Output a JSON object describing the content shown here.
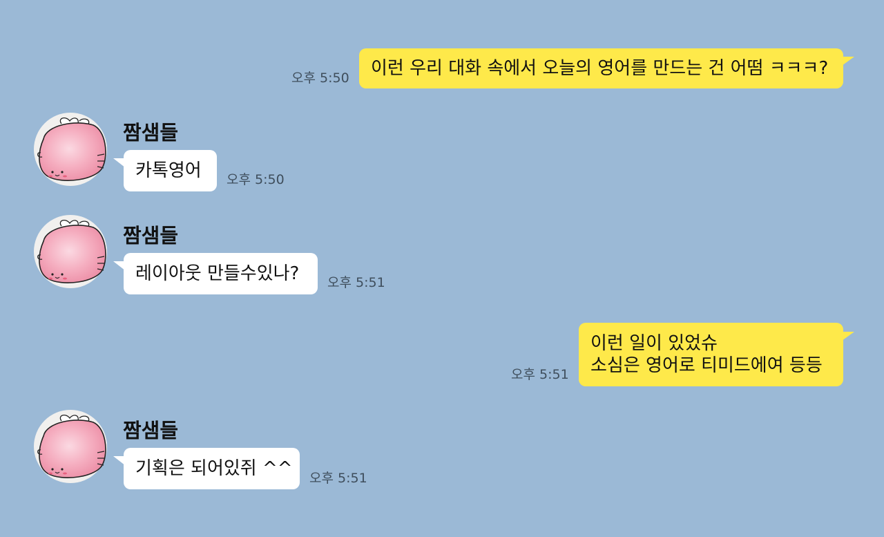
{
  "colors": {
    "background": "#9bb9d6",
    "my_bubble": "#fee94a",
    "their_bubble": "#ffffff",
    "avatar_pink": "#f3a2b6"
  },
  "messages": [
    {
      "sender": "me",
      "lines": [
        "이런 우리 대화 속에서 오늘의 영어를 만드는 건 어떰 ㅋㅋㅋ?"
      ],
      "time": "오후 5:50"
    },
    {
      "sender": "짬샘들",
      "avatar": "pink-blob-avatar-icon",
      "lines": [
        "카톡영어"
      ],
      "time": "오후 5:50"
    },
    {
      "sender": "짬샘들",
      "avatar": "pink-blob-avatar-icon",
      "lines": [
        "레이아웃 만들수있나?"
      ],
      "time": "오후 5:51"
    },
    {
      "sender": "me",
      "lines": [
        "이런 일이 있었슈",
        "소심은 영어로 티미드에여 등등"
      ],
      "time": "오후 5:51"
    },
    {
      "sender": "짬샘들",
      "avatar": "pink-blob-avatar-icon",
      "lines": [
        "기획은 되어있쥐 ^^"
      ],
      "time": "오후 5:51"
    }
  ]
}
